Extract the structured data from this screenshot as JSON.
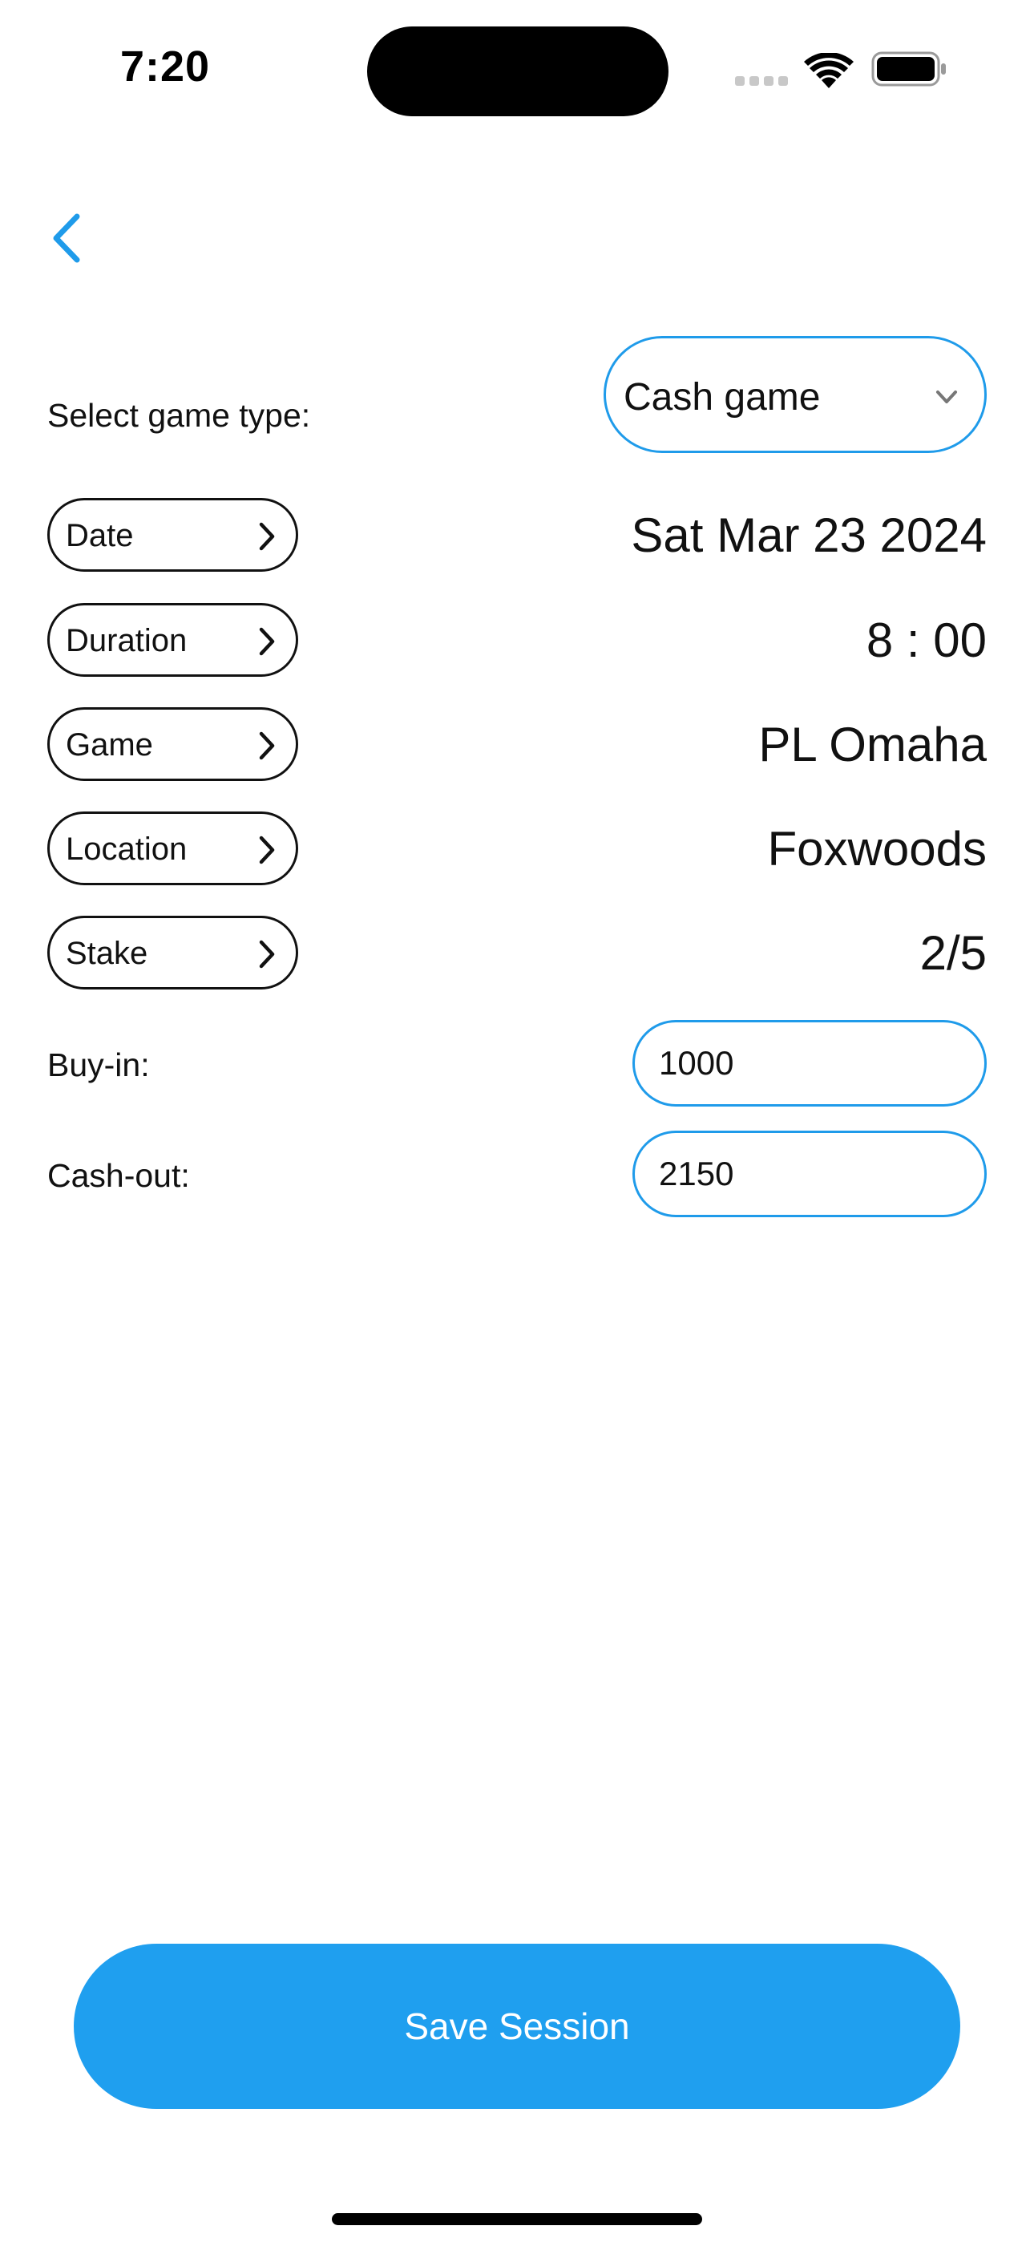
{
  "status_bar": {
    "time": "7:20"
  },
  "game_type": {
    "label": "Select game type:",
    "selected": "Cash game"
  },
  "rows": [
    {
      "button": "Date",
      "value": "Sat Mar 23 2024"
    },
    {
      "button": "Duration",
      "value": "8 : 00"
    },
    {
      "button": "Game",
      "value": "PL Omaha"
    },
    {
      "button": "Location",
      "value": "Foxwoods"
    },
    {
      "button": "Stake",
      "value": "2/5"
    }
  ],
  "buy_in": {
    "label": "Buy-in:",
    "value": "1000"
  },
  "cash_out": {
    "label": "Cash-out:",
    "value": "2150"
  },
  "save_label": "Save Session",
  "colors": {
    "accent": "#1f9fef",
    "border_blue": "#1f9bea",
    "text": "#111111"
  }
}
